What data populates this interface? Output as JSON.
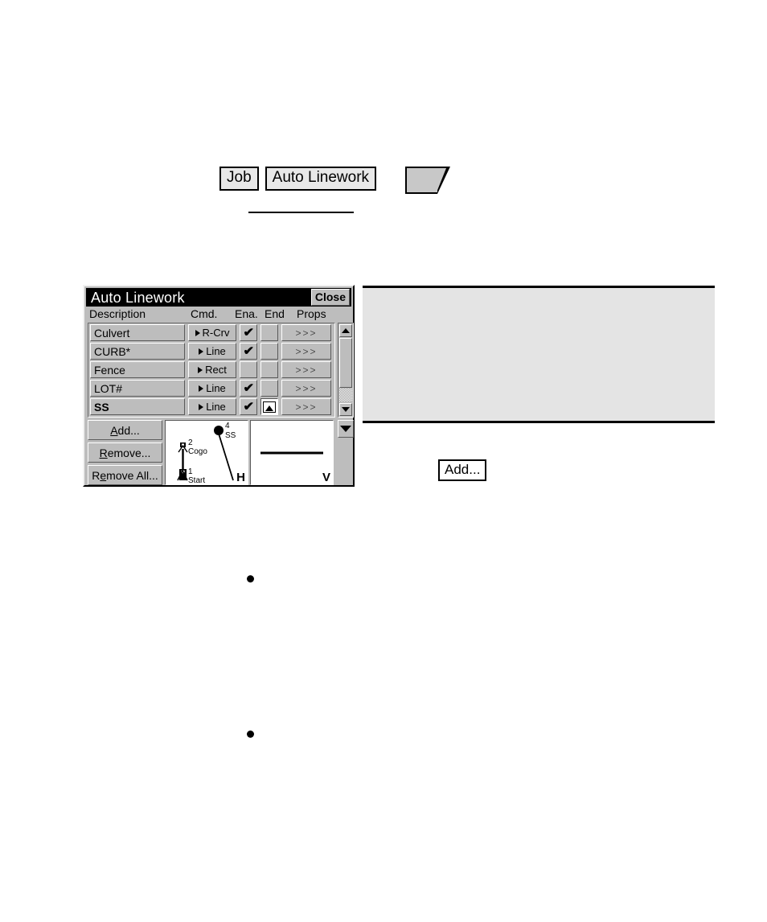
{
  "breadcrumb": {
    "items": [
      {
        "label": "Job"
      },
      {
        "label": "Auto Linework"
      }
    ],
    "shape_icon": "screen-shape-icon"
  },
  "dialog": {
    "title": "Auto Linework",
    "close_label": "Close",
    "columns": {
      "description": "Description",
      "cmd": "Cmd.",
      "ena": "Ena.",
      "end": "End",
      "props": "Props"
    },
    "rows": [
      {
        "description": "Culvert",
        "cmd": "R-Crv",
        "ena": true,
        "end": "",
        "props": ">>>",
        "selected": false
      },
      {
        "description": "CURB*",
        "cmd": "Line",
        "ena": true,
        "end": "",
        "props": ">>>",
        "selected": false
      },
      {
        "description": "Fence",
        "cmd": "Rect",
        "ena": false,
        "end": "",
        "props": ">>>",
        "selected": false
      },
      {
        "description": "LOT#",
        "cmd": "Line",
        "ena": true,
        "end": "",
        "props": ">>>",
        "selected": false
      },
      {
        "description": "SS",
        "cmd": "Line",
        "ena": true,
        "end": "peak-icon",
        "props": ">>>",
        "selected": true
      }
    ],
    "check_glyph": "✔",
    "buttons": {
      "add": "Add...",
      "add_mnemonic": "A",
      "remove": "Remove...",
      "remove_mnemonic": "R",
      "remove_all": "Remove All...",
      "remove_all_mnemonic": "e"
    },
    "preview_h": {
      "label": "H",
      "points": [
        {
          "number": "1",
          "name": "Start"
        },
        {
          "number": "2",
          "name": "Cogo"
        },
        {
          "number": "4",
          "name": "SS"
        }
      ]
    },
    "preview_v": {
      "label": "V"
    },
    "scrollbar": {
      "up_icon": "triangle-up-icon",
      "down_icon": "triangle-down-icon"
    },
    "dropdown_icon": "triangle-down-icon"
  },
  "callout": {
    "text": ""
  },
  "inline_chip": {
    "label": "Add..."
  },
  "colors": {
    "dialog_face": "#bdbdbd",
    "titlebar": "#000000",
    "callout_fill": "#e4e4e4",
    "crumb_fill": "#e8e8e8"
  }
}
